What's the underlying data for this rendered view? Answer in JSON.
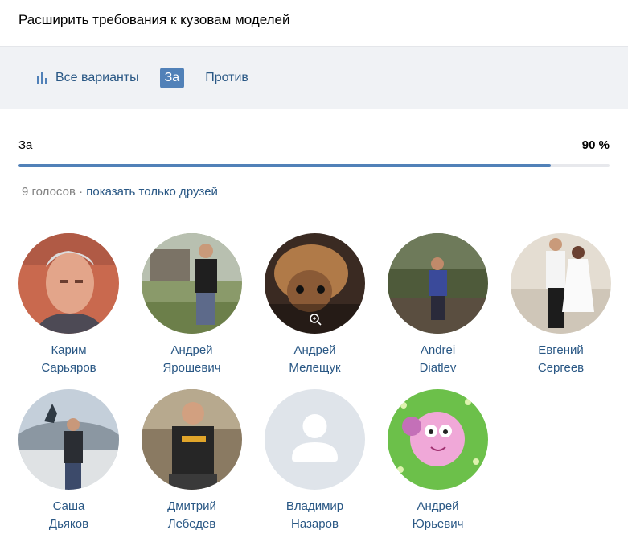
{
  "header": {
    "title": "Расширить требования к кузовам моделей"
  },
  "tabs": [
    {
      "label": "Все варианты",
      "icon": "bar-chart-icon"
    },
    {
      "label": "За",
      "active": true
    },
    {
      "label": "Против"
    }
  ],
  "result": {
    "label": "За",
    "percent": "90 %",
    "fill": 0.9,
    "votes": "9 голосов",
    "separator": "·",
    "friends_link": "показать только друзей"
  },
  "people": [
    {
      "first": "Карим",
      "last": "Сарьяров"
    },
    {
      "first": "Андрей",
      "last": "Ярошевич"
    },
    {
      "first": "Андрей",
      "last": "Мелещук"
    },
    {
      "first": "Andrei",
      "last": "Diatlev"
    },
    {
      "first": "Евгений",
      "last": "Сергеев"
    },
    {
      "first": "Саша",
      "last": "Дьяков"
    },
    {
      "first": "Дмитрий",
      "last": "Лебедев"
    },
    {
      "first": "Владимир",
      "last": "Назаров"
    },
    {
      "first": "Андрей",
      "last": "Юрьевич"
    }
  ],
  "colors": {
    "accent": "#5181b8",
    "link": "#2a5885",
    "muted": "#828282"
  }
}
